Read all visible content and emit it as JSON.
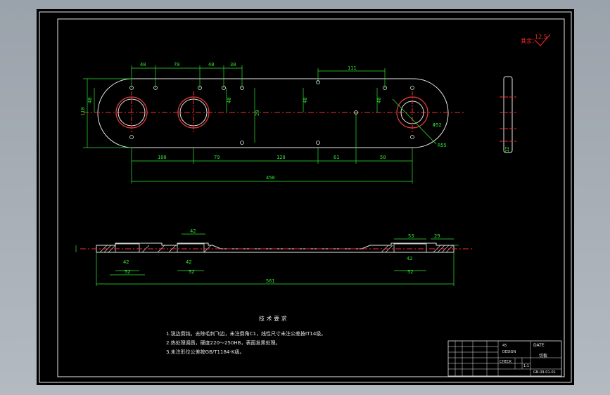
{
  "drawing": {
    "title_block": {
      "part_name": "切板",
      "material": "45",
      "drawing_no": "GB-09-01-01",
      "scale": "1:1",
      "school": "DATE",
      "field_a": "DESIGN",
      "field_b": "CHECK"
    },
    "roughness_note": {
      "label": "其余：",
      "value": "12.5"
    },
    "technical_requirements": {
      "title": "技 术 要 求",
      "lines": [
        "1.锐边倒钝，去除毛刺飞边，未注倒角C1，线性尺寸未注公差按IT14级。",
        "2.热处理调质，硬度220～250HB，表面发黑处理。",
        "3.未注形位公差按GB/T1184-K级。"
      ]
    },
    "dimensions": {
      "top_chain": [
        "40",
        "70",
        "40",
        "30"
      ],
      "top_right": "111",
      "left_height": "110",
      "left_small": "40",
      "mid_vertical_a": "40",
      "mid_vertical_b": "40",
      "mid_vertical_c": "40",
      "mid_vertical_d": "20",
      "bottom_chain": [
        "100",
        "79",
        "120",
        "61",
        "50"
      ],
      "overall_length": "450",
      "hole_dia": "Φ52",
      "radius": "R55",
      "section_overall": "561",
      "section_bores": [
        "42",
        "52",
        "42",
        "52",
        "42",
        "52"
      ],
      "section_right": "29",
      "section_top_a": "42",
      "section_top_b": "53",
      "side_thk": "12"
    }
  }
}
